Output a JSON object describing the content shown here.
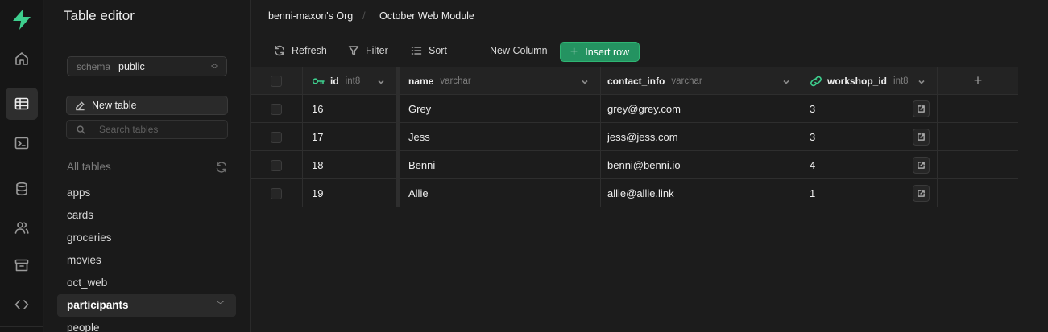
{
  "sidebar": {
    "title": "Table editor",
    "schema": {
      "label": "schema",
      "value": "public"
    },
    "new_table_label": "New table",
    "search_placeholder": "Search tables",
    "all_tables_label": "All tables",
    "tables": [
      "apps",
      "cards",
      "groceries",
      "movies",
      "oct_web",
      "participants",
      "people"
    ],
    "selected_table": "participants"
  },
  "rail": {
    "icons": [
      "supabase-logo-icon",
      "home-icon",
      "table-editor-icon",
      "sql-editor-icon",
      "database-icon",
      "users-icon",
      "storage-icon",
      "api-code-icon"
    ]
  },
  "header": {
    "breadcrumb": [
      "benni-maxon's Org",
      "October Web Module"
    ],
    "breadcrumb_separator": "/"
  },
  "toolbar": {
    "refresh_label": "Refresh",
    "filter_label": "Filter",
    "sort_label": "Sort",
    "new_column_label": "New Column",
    "insert_row_label": "Insert row"
  },
  "table": {
    "columns": [
      {
        "name": "id",
        "type": "int8",
        "primary_key": true
      },
      {
        "name": "name",
        "type": "varchar"
      },
      {
        "name": "contact_info",
        "type": "varchar"
      },
      {
        "name": "workshop_id",
        "type": "int8",
        "foreign_key": true
      }
    ],
    "rows": [
      {
        "id": "16",
        "name": "Grey",
        "contact_info": "grey@grey.com",
        "workshop_id": "3"
      },
      {
        "id": "17",
        "name": "Jess",
        "contact_info": "jess@jess.com",
        "workshop_id": "3"
      },
      {
        "id": "18",
        "name": "Benni",
        "contact_info": "benni@benni.io",
        "workshop_id": "4"
      },
      {
        "id": "19",
        "name": "Allie",
        "contact_info": "allie@allie.link",
        "workshop_id": "1"
      }
    ],
    "add_column_symbol": "+"
  },
  "colors": {
    "accent_green": "#3ecf8e",
    "insert_button_bg": "#249361",
    "background": "#1c1c1c"
  }
}
